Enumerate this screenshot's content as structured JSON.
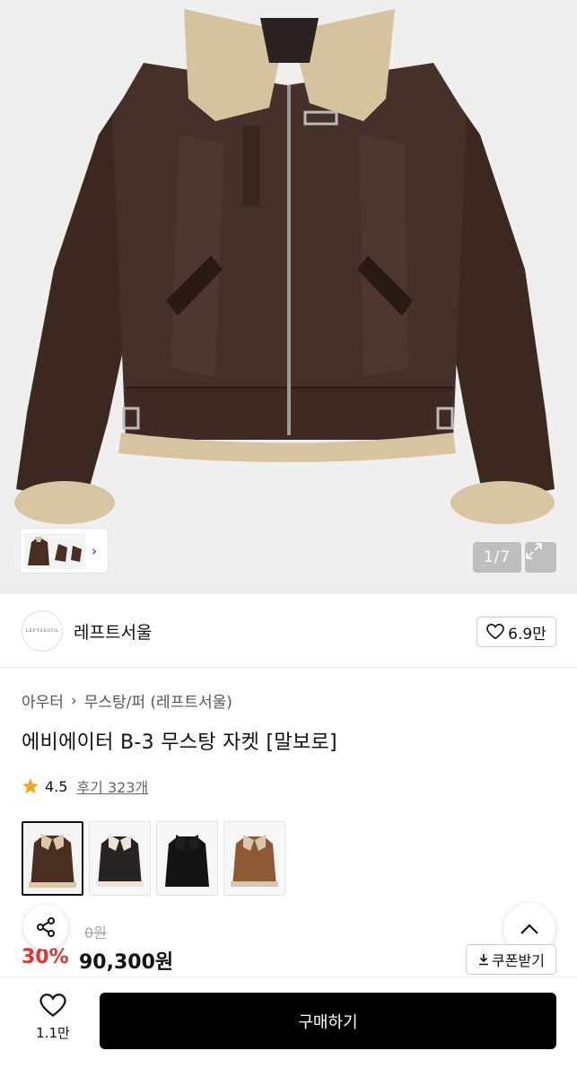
{
  "gallery": {
    "counter": "1/7",
    "expand_icon": "expand-icon",
    "thumb_chevron": "›"
  },
  "brand": {
    "logo_text": "LEFTSEOUL",
    "name": "레프트서울",
    "like_count": "6.9만"
  },
  "breadcrumb": {
    "category": "아우터",
    "separator": "›",
    "subcategory": "무스탕/퍼 (레프트서울)"
  },
  "product": {
    "title": "에비에이터 B-3 무스탕 자켓 [말보로]",
    "rating": "4.5",
    "reviews": "후기 323개"
  },
  "swatches": [
    {
      "color": "#4a2e22",
      "collar": "#d9c7a6",
      "selected": true
    },
    {
      "color": "#2a2323",
      "collar": "#ece4d6",
      "selected": false
    },
    {
      "color": "#141414",
      "collar": "#1e1e1e",
      "selected": false
    },
    {
      "color": "#8e5a35",
      "collar": "#d8c7ad",
      "selected": false
    }
  ],
  "price": {
    "original": "0원",
    "discount": "30%",
    "final": "90,300원",
    "coupon_label": "쿠폰받기"
  },
  "bottom": {
    "wish_count": "1.1만",
    "buy_label": "구매하기"
  },
  "colors": {
    "accent_red": "#e8322e",
    "buy_button": "#000000"
  }
}
